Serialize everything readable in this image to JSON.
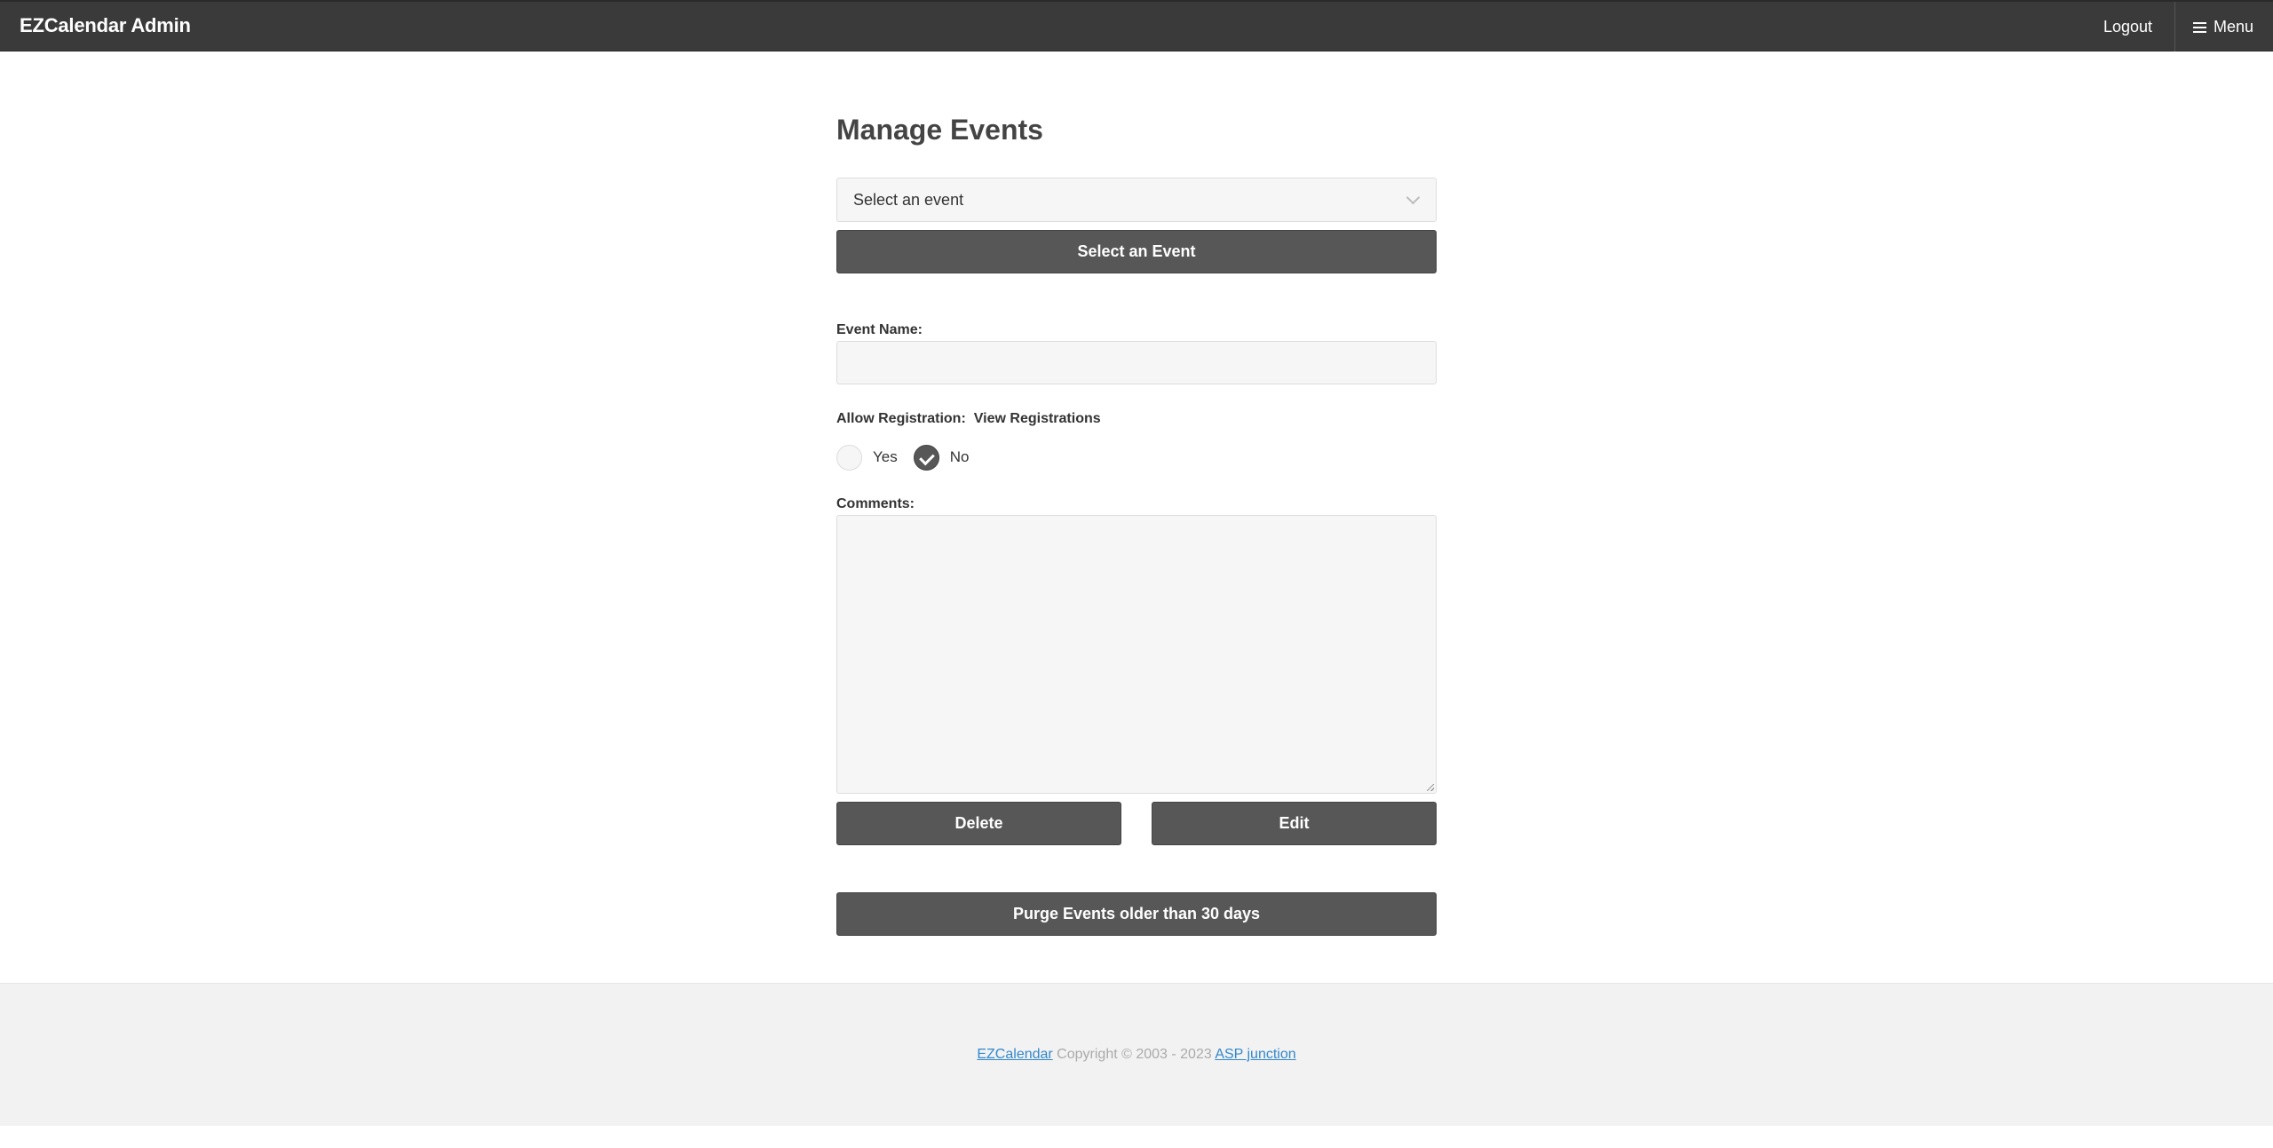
{
  "header": {
    "title": "EZCalendar Admin",
    "logout_label": "Logout",
    "menu_label": "Menu",
    "menu_icon": "hamburger-icon"
  },
  "main": {
    "page_title": "Manage Events",
    "event_select": {
      "selected_text": "Select an event",
      "icon": "chevron-down-icon"
    },
    "select_button_label": "Select an Event",
    "event_name_label": "Event Name:",
    "event_name_value": "",
    "allow_registration_label": "Allow Registration:",
    "view_registrations_label": "View Registrations",
    "registration_options": [
      {
        "label": "Yes",
        "checked": false
      },
      {
        "label": "No",
        "checked": true
      }
    ],
    "comments_label": "Comments:",
    "comments_value": "",
    "delete_button_label": "Delete",
    "edit_button_label": "Edit",
    "purge_button_label": "Purge Events older than 30 days"
  },
  "footer": {
    "link_1": "EZCalendar",
    "copyright": " Copyright © 2003 - 2023 ",
    "link_2": "ASP junction"
  },
  "colors": {
    "header_bg": "#3a3a3a",
    "button_bg": "#575757",
    "input_bg": "#f6f6f6",
    "footer_bg": "#f2f2f2",
    "link": "#3388cc"
  }
}
